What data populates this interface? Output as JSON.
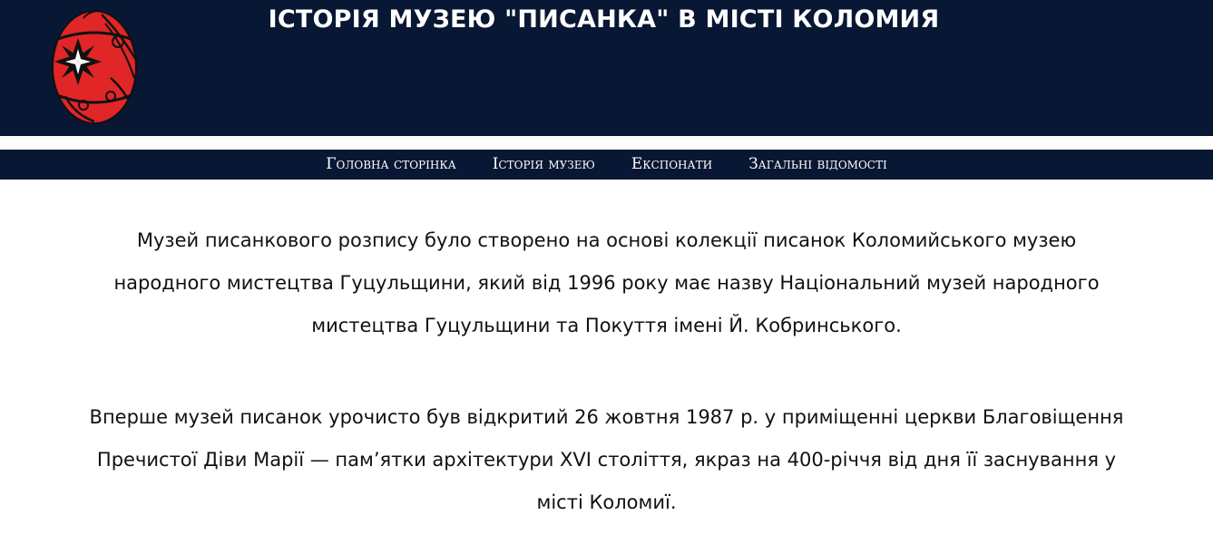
{
  "header": {
    "title": "ІСТОРІЯ МУЗЕЮ \"ПИСАНКА\" В МІСТІ КОЛОМИЯ",
    "logo_icon": "pysanka-egg-icon",
    "background_color": "#081733"
  },
  "nav": {
    "items": [
      {
        "label": "Головна сторінка"
      },
      {
        "label": "Історія музею"
      },
      {
        "label": "Експонати"
      },
      {
        "label": "Загальні відомості"
      }
    ]
  },
  "main": {
    "paragraphs": [
      "Музей писанкового розпису було створено на основі колекції писанок Коломийського музею народного мистецтва Гуцульщини, який від 1996 року має назву Національний музей народного мистецтва Гуцульщини та Покуття імені Й. Кобринського.",
      "Вперше музей писанок урочисто був відкритий 26 жовтня 1987 р. у приміщенні церкви Благовіщення Пречистої Діви Марії — пам’ятки архітектури XVI століття, якраз на 400-річчя від дня її заснування у місті Коломиї."
    ]
  }
}
